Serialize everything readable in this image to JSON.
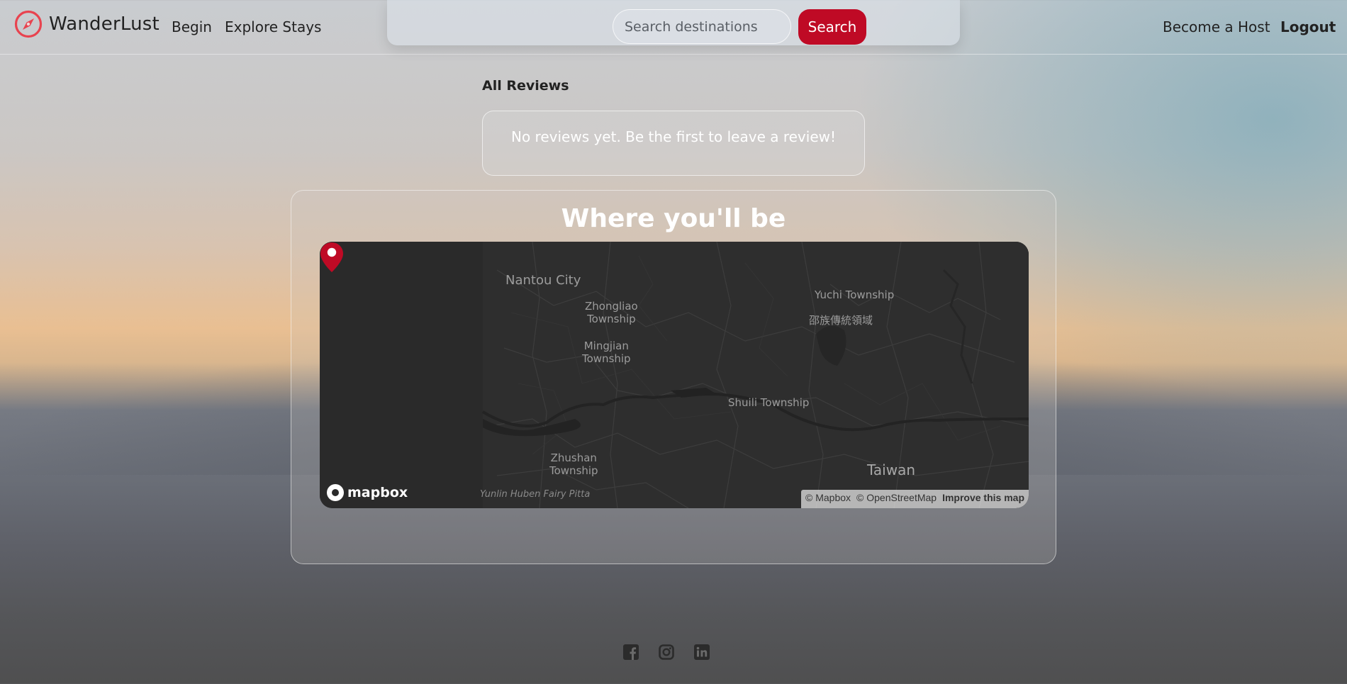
{
  "header": {
    "brand": "WanderLust",
    "nav_links": [
      "Begin",
      "Explore Stays"
    ],
    "search_placeholder": "Search destinations",
    "search_button": "Search",
    "host_link": "Become a Host",
    "logout": "Logout"
  },
  "reviews": {
    "heading": "All Reviews",
    "empty_message": "No reviews yet. Be the first to leave a review!"
  },
  "map_section": {
    "title": "Where you'll be",
    "labels": {
      "nantou": "Nantou City",
      "zhongliao": "Zhongliao\nTownship",
      "yuchi": "Yuchi Township",
      "indigenous": "邵族傳統領域",
      "mingjian": "Mingjian\nTownship",
      "shuili": "Shuili Township",
      "zhushan": "Zhushan\nTownship",
      "taiwan": "Taiwan",
      "yunlin": "Yunlin Huben Fairy Pitta"
    },
    "logo": "mapbox",
    "attribution": {
      "mapbox": "© Mapbox",
      "osm": "© OpenStreetMap",
      "improve": "Improve this map"
    },
    "colors": {
      "pin": "#bf0a25",
      "map_bg": "#2a2a2a"
    }
  },
  "footer": {
    "social_icons": [
      "facebook-icon",
      "instagram-icon",
      "linkedin-icon"
    ]
  },
  "accent_color": "#bf0a25"
}
